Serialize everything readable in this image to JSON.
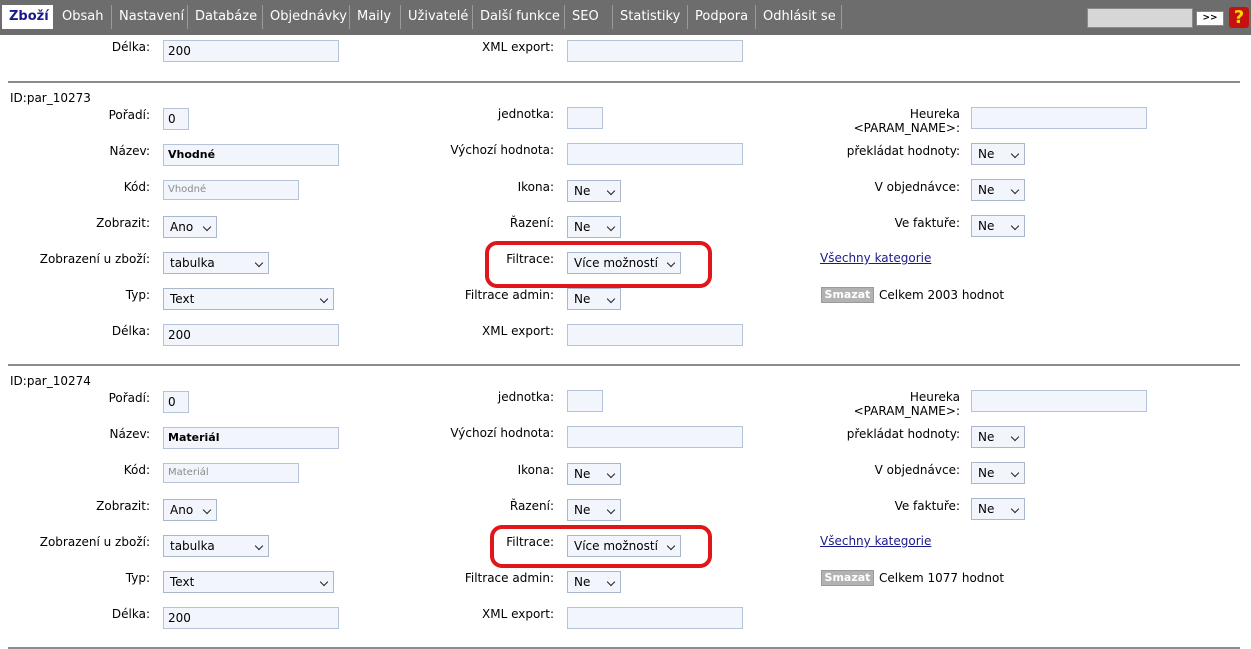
{
  "nav": {
    "items": [
      "Zboží",
      "Obsah",
      "Nastavení",
      "Databáze",
      "Objednávky",
      "Maily",
      "Uživatelé",
      "Další funkce",
      "SEO",
      "Statistiky",
      "Podpora",
      "Odhlásit se"
    ],
    "search_value": "",
    "go_label": ">>",
    "help_glyph": "?"
  },
  "labels": {
    "poradi": "Pořadí:",
    "nazev": "Název:",
    "kod": "Kód:",
    "zobrazit": "Zobrazit:",
    "zobrazeni": "Zobrazení u zboží:",
    "typ": "Typ:",
    "delka": "Délka:",
    "jednotka": "jednotka:",
    "vychozi": "Výchozí hodnota:",
    "ikona": "Ikona:",
    "razeni": "Řazení:",
    "filtrace": "Filtrace:",
    "filtrace_admin": "Filtrace admin:",
    "xml": "XML export:",
    "heureka": "Heureka <PARAM_NAME>:",
    "prekladat": "překládat hodnoty:",
    "v_objednavce": "V objednávce:",
    "ve_fakture": "Ve faktuře:"
  },
  "top_partial": {
    "delka_value": "200",
    "xml_value": ""
  },
  "sections": [
    {
      "id_label": "ID:par_10273",
      "poradi": "0",
      "nazev": "Vhodné",
      "kod": "Vhodné",
      "zobrazit": "Ano",
      "zobrazeni": "tabulka",
      "typ": "Text",
      "delka": "200",
      "jednotka": "",
      "vychozi": "",
      "ikona": "Ne",
      "razeni": "Ne",
      "filtrace": "Více možností",
      "filtrace_admin": "Ne",
      "xml": "",
      "heureka": "",
      "prekladat": "Ne",
      "v_objednavce": "Ne",
      "ve_fakture": "Ne",
      "categories_link": "Všechny kategorie",
      "delete_label": "Smazat",
      "count_text": "Celkem 2003 hodnot"
    },
    {
      "id_label": "ID:par_10274",
      "poradi": "0",
      "nazev": "Materiál",
      "kod": "Materiál",
      "zobrazit": "Ano",
      "zobrazeni": "tabulka",
      "typ": "Text",
      "delka": "200",
      "jednotka": "",
      "vychozi": "",
      "ikona": "Ne",
      "razeni": "Ne",
      "filtrace": "Více možností",
      "filtrace_admin": "Ne",
      "xml": "",
      "heureka": "",
      "prekladat": "Ne",
      "v_objednavce": "Ne",
      "ve_fakture": "Ne",
      "categories_link": "Všechny kategorie",
      "delete_label": "Smazat",
      "count_text": "Celkem 1077 hodnot"
    }
  ],
  "colors": {
    "nav_bg": "#6d6d6d",
    "active_tab_text": "#1a1a8c",
    "highlight": "#e0161b",
    "link": "#1a1a8c"
  }
}
